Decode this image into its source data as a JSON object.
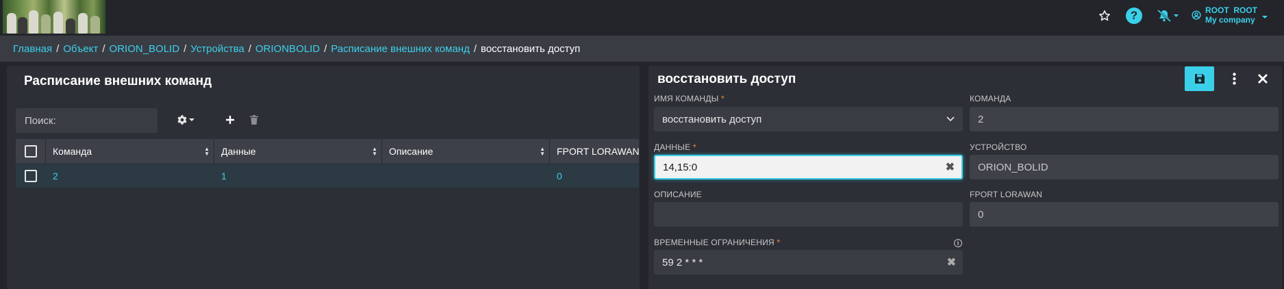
{
  "topbar": {
    "user_name": "ROOT  ROOT",
    "user_company": "My company"
  },
  "breadcrumb": {
    "items": [
      "Главная",
      "Объект",
      "ORION_BOLID",
      "Устройства",
      "ORIONBOLID",
      "Расписание внешних команд"
    ],
    "current": "восстановить доступ",
    "separator": "/"
  },
  "left": {
    "title": "Расписание внешних команд",
    "search_placeholder": "Поиск:",
    "columns": [
      "Команда",
      "Данные",
      "Описание",
      "FPORT LORAWAN"
    ],
    "rows": [
      {
        "command": "2",
        "data": "1",
        "description": "",
        "fport": "0"
      }
    ]
  },
  "right": {
    "title": "восстановить доступ",
    "fields": {
      "command_name": {
        "label": "ИМЯ КОМАНДЫ",
        "required": "*",
        "value": "восстановить доступ"
      },
      "command": {
        "label": "КОМАНДА",
        "value": "2"
      },
      "data": {
        "label": "ДАННЫЕ",
        "required": "*",
        "value": "14,15:0"
      },
      "device": {
        "label": "УСТРОЙСТВО",
        "value": "ORION_BOLID"
      },
      "description": {
        "label": "ОПИСАНИЕ",
        "value": ""
      },
      "fport": {
        "label": "FPORT LORAWAN",
        "value": "0"
      },
      "time_limits": {
        "label": "ВРЕМЕННЫЕ ОГРАНИЧЕНИЯ",
        "required": "*",
        "value": "59 2 * * *"
      }
    }
  },
  "colors": {
    "accent": "#3bd0e9",
    "background": "#23252b",
    "panel": "#2d2f36",
    "required": "#f08c3a"
  }
}
